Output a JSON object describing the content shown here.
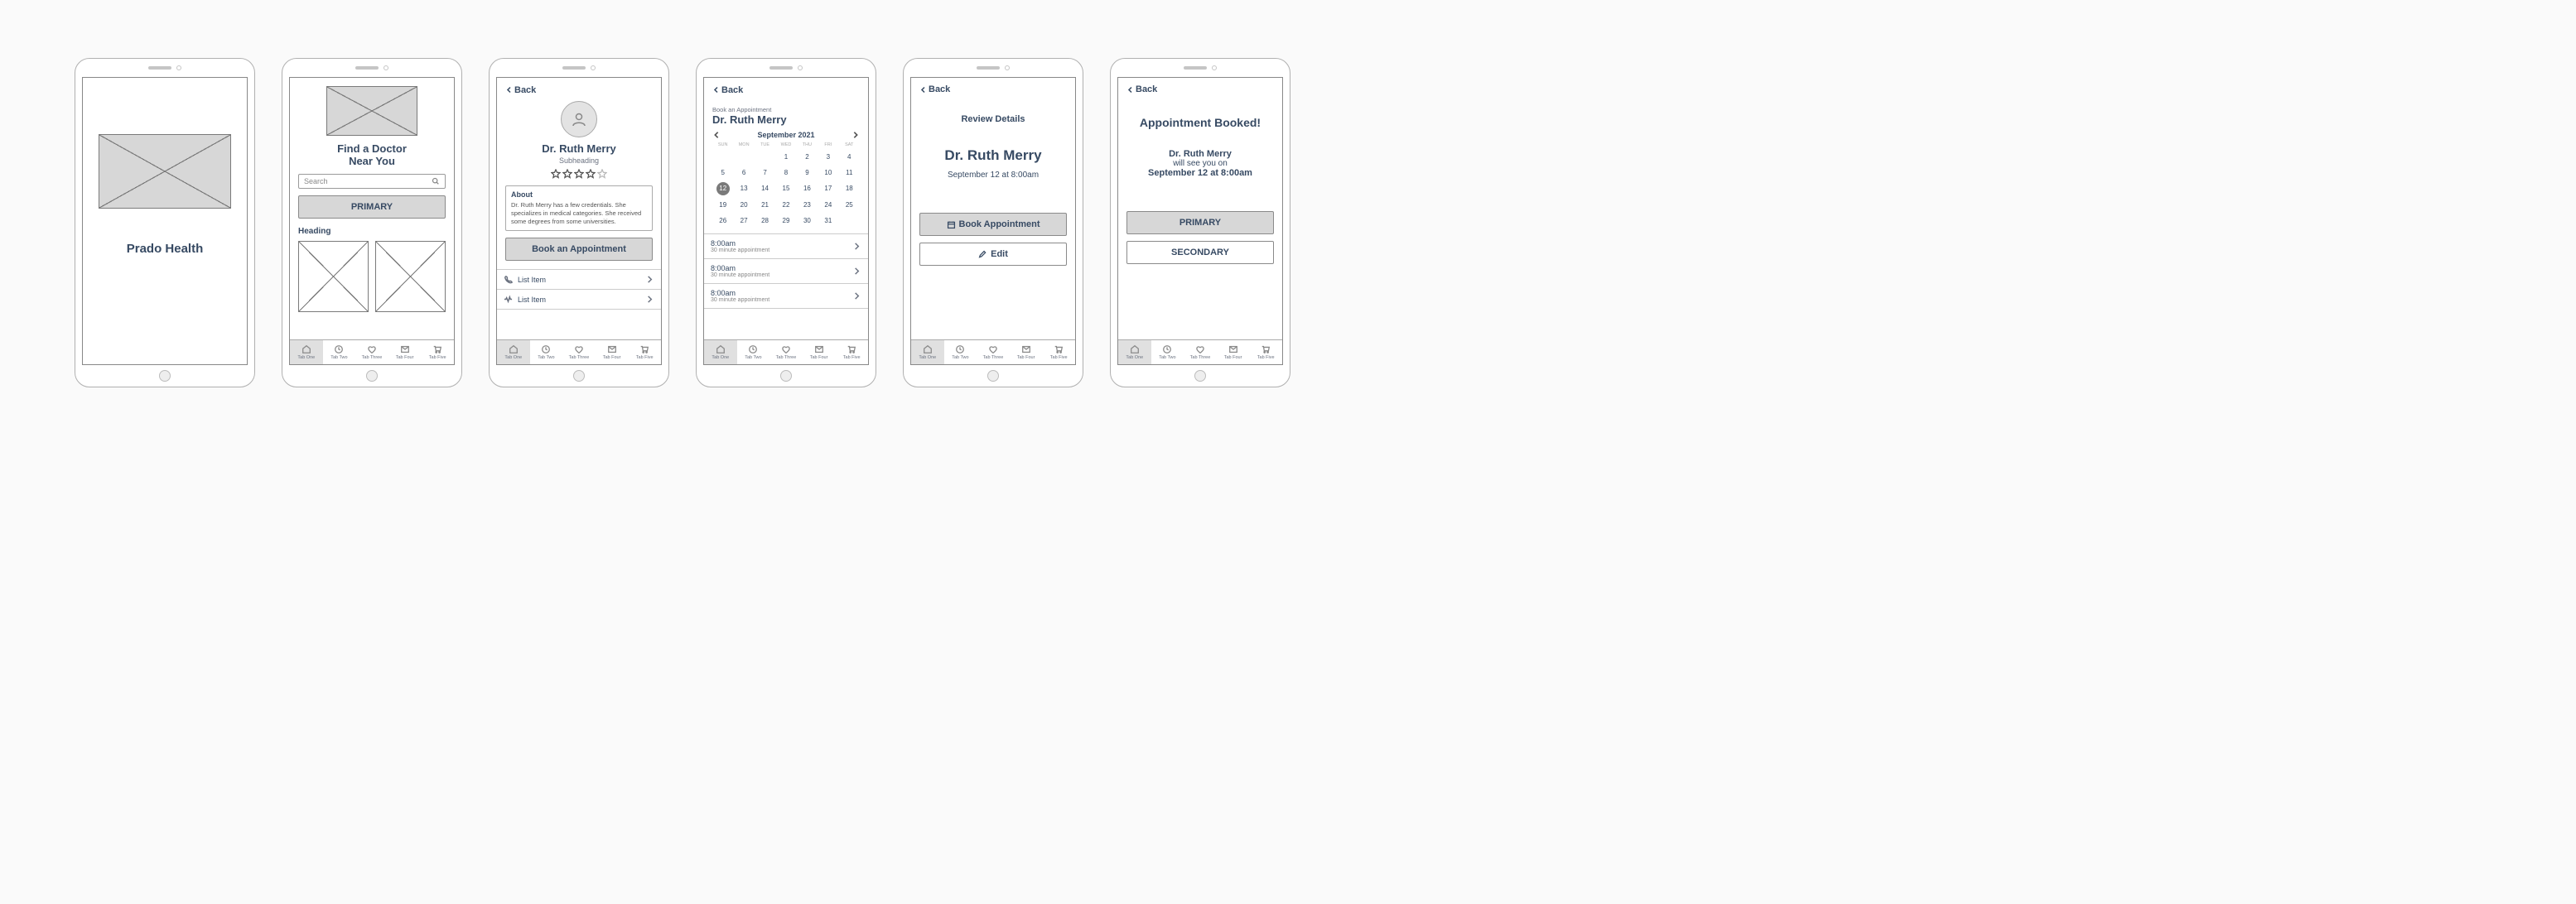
{
  "tabs": [
    {
      "label": "Tab One",
      "icon": "home"
    },
    {
      "label": "Tab Two",
      "icon": "clock"
    },
    {
      "label": "Tab Three",
      "icon": "heart"
    },
    {
      "label": "Tab Four",
      "icon": "mail"
    },
    {
      "label": "Tab Five",
      "icon": "cart"
    }
  ],
  "s1": {
    "title": "Prado Health"
  },
  "s2": {
    "title_l1": "Find a Doctor",
    "title_l2": "Near You",
    "search_placeholder": "Search",
    "primary": "PRIMARY",
    "heading": "Heading"
  },
  "s3": {
    "back": "Back",
    "name": "Dr. Ruth Merry",
    "subheading": "Subheading",
    "about_hd": "About",
    "about_bd": "Dr. Ruth Merry has a few credentials. She specializes in medical categories. She received some degrees from some universities.",
    "book": "Book an Appointment",
    "list1": "List Item",
    "list2": "List Item"
  },
  "s4": {
    "back": "Back",
    "overline": "Book an Appointment",
    "name": "Dr. Ruth Merry",
    "month": "September 2021",
    "dow": [
      "SUN",
      "MON",
      "TUE",
      "WED",
      "THU",
      "FRI",
      "SAT"
    ],
    "days": [
      1,
      2,
      3,
      4,
      5,
      6,
      7,
      8,
      9,
      10,
      11,
      12,
      13,
      14,
      15,
      16,
      17,
      18,
      19,
      20,
      21,
      22,
      23,
      24,
      25,
      26,
      27,
      28,
      29,
      30,
      31
    ],
    "selected": 12,
    "slots": [
      {
        "time": "8:00am",
        "desc": "30 minute appointment"
      },
      {
        "time": "8:00am",
        "desc": "30 minute appointment"
      },
      {
        "time": "8:00am",
        "desc": "30 minute appointment"
      }
    ]
  },
  "s5": {
    "back": "Back",
    "review": "Review Details",
    "name": "Dr. Ruth Merry",
    "when": "September 12 at 8:00am",
    "book": "Book Appointment",
    "edit": "Edit"
  },
  "s6": {
    "back": "Back",
    "title": "Appointment Booked!",
    "name": "Dr. Ruth Merry",
    "mid": "will see you on",
    "when": "September 12 at 8:00am",
    "primary": "PRIMARY",
    "secondary": "SECONDARY"
  }
}
